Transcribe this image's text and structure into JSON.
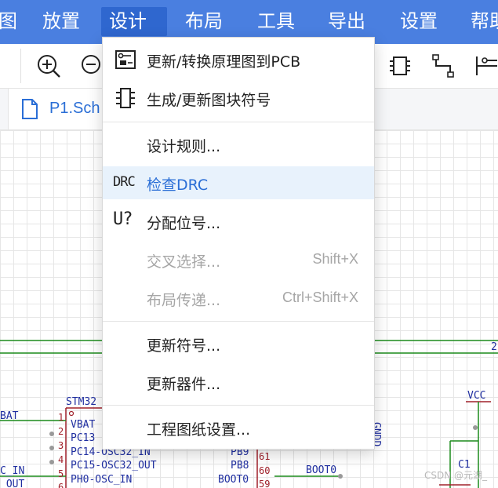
{
  "menubar": {
    "items": [
      {
        "label": "图"
      },
      {
        "label": "放置"
      },
      {
        "label": "设计"
      },
      {
        "label": "布局"
      },
      {
        "label": "工具"
      },
      {
        "label": "导出"
      },
      {
        "label": "设置"
      },
      {
        "label": "帮助"
      }
    ],
    "active_index": 2,
    "color": "#4a7fe0",
    "active_color": "#2f67cf"
  },
  "toolbar": {
    "icons": [
      "zoom-in-icon",
      "zoom-out-icon",
      "chip-icon",
      "net-label-icon",
      "pin-icon"
    ]
  },
  "tabs": [
    {
      "label": "P1.Sch",
      "icon": "document-icon"
    }
  ],
  "dropdown": {
    "items": [
      {
        "label": "更新/转换原理图到PCB",
        "icon": "pcb-update-icon",
        "enabled": true
      },
      {
        "label": "生成/更新图块符号",
        "icon": "symbol-block-icon",
        "enabled": true
      },
      {
        "label": "设计规则...",
        "enabled": true
      },
      {
        "label": "检查DRC",
        "icon_text": "DRC",
        "enabled": true,
        "hovered": true
      },
      {
        "label": "分配位号...",
        "icon_text": "U?",
        "enabled": true
      },
      {
        "label": "交叉选择...",
        "shortcut": "Shift+X",
        "enabled": false
      },
      {
        "label": "布局传递...",
        "shortcut": "Ctrl+Shift+X",
        "enabled": false
      },
      {
        "label": "更新符号...",
        "enabled": true
      },
      {
        "label": "更新器件...",
        "enabled": true
      },
      {
        "label": "工程图纸设置...",
        "enabled": true
      }
    ],
    "hover_color": "#e8f2fc",
    "accent": "#2a6ed6"
  },
  "schematic": {
    "component_ref": "STM32",
    "left_labels": [
      "BAT",
      "C_IN",
      "_OUT"
    ],
    "pins_left": [
      {
        "num": "1",
        "name": "VBAT"
      },
      {
        "num": "2",
        "name": "PC13"
      },
      {
        "num": "3",
        "name": "PC14-OSC32_IN"
      },
      {
        "num": "4",
        "name": "PC15-OSC32_OUT"
      },
      {
        "num": "5",
        "name": "PH0-OSC_IN"
      },
      {
        "num": "6",
        "name": ""
      }
    ],
    "pins_right": [
      {
        "num": "61",
        "name": "PB9"
      },
      {
        "num": "60",
        "name": "PB8"
      },
      {
        "num": "59",
        "name": "BOOT0"
      }
    ],
    "net_boot": "BOOT0",
    "gnd_label": "GNDD",
    "vcc_label": "VCC",
    "cap_label": "C1",
    "net_number": "2"
  },
  "watermark": "CSDN @元湖_"
}
